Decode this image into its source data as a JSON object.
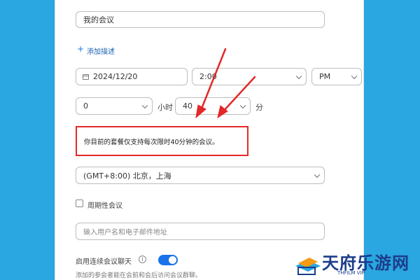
{
  "meeting": {
    "topic": "我的会议",
    "add_description": "添加描述",
    "date": "2024/12/20",
    "time": "2:00",
    "ampm": "PM",
    "duration_hours": "0",
    "hours_unit": "小时",
    "duration_minutes": "40",
    "minutes_unit": "分",
    "warning": "你目前的套餐仅支持每次限时40分钟的会议。",
    "timezone": "(GMT+8:00) 北京，上海",
    "recurring_label": "周期性会议",
    "invitee_placeholder": "输入用户名和电子邮件地址",
    "continuous_chat_label": "启用连续会议聊天",
    "continuous_chat_desc": "添加的参会者能在会前和会后访问会议群聊。"
  },
  "watermark": {
    "brand": "天府乐游网",
    "sub": "THFILM VIP"
  },
  "colors": {
    "background": "#2aa6e0",
    "highlight": "#e32828",
    "toggle": "#1a73e8",
    "brand": "#1b3d8c"
  },
  "icons": [
    "plus-icon",
    "calendar-icon",
    "chevron-down-icon",
    "info-icon",
    "toggle-switch",
    "red-arrow-icon"
  ]
}
